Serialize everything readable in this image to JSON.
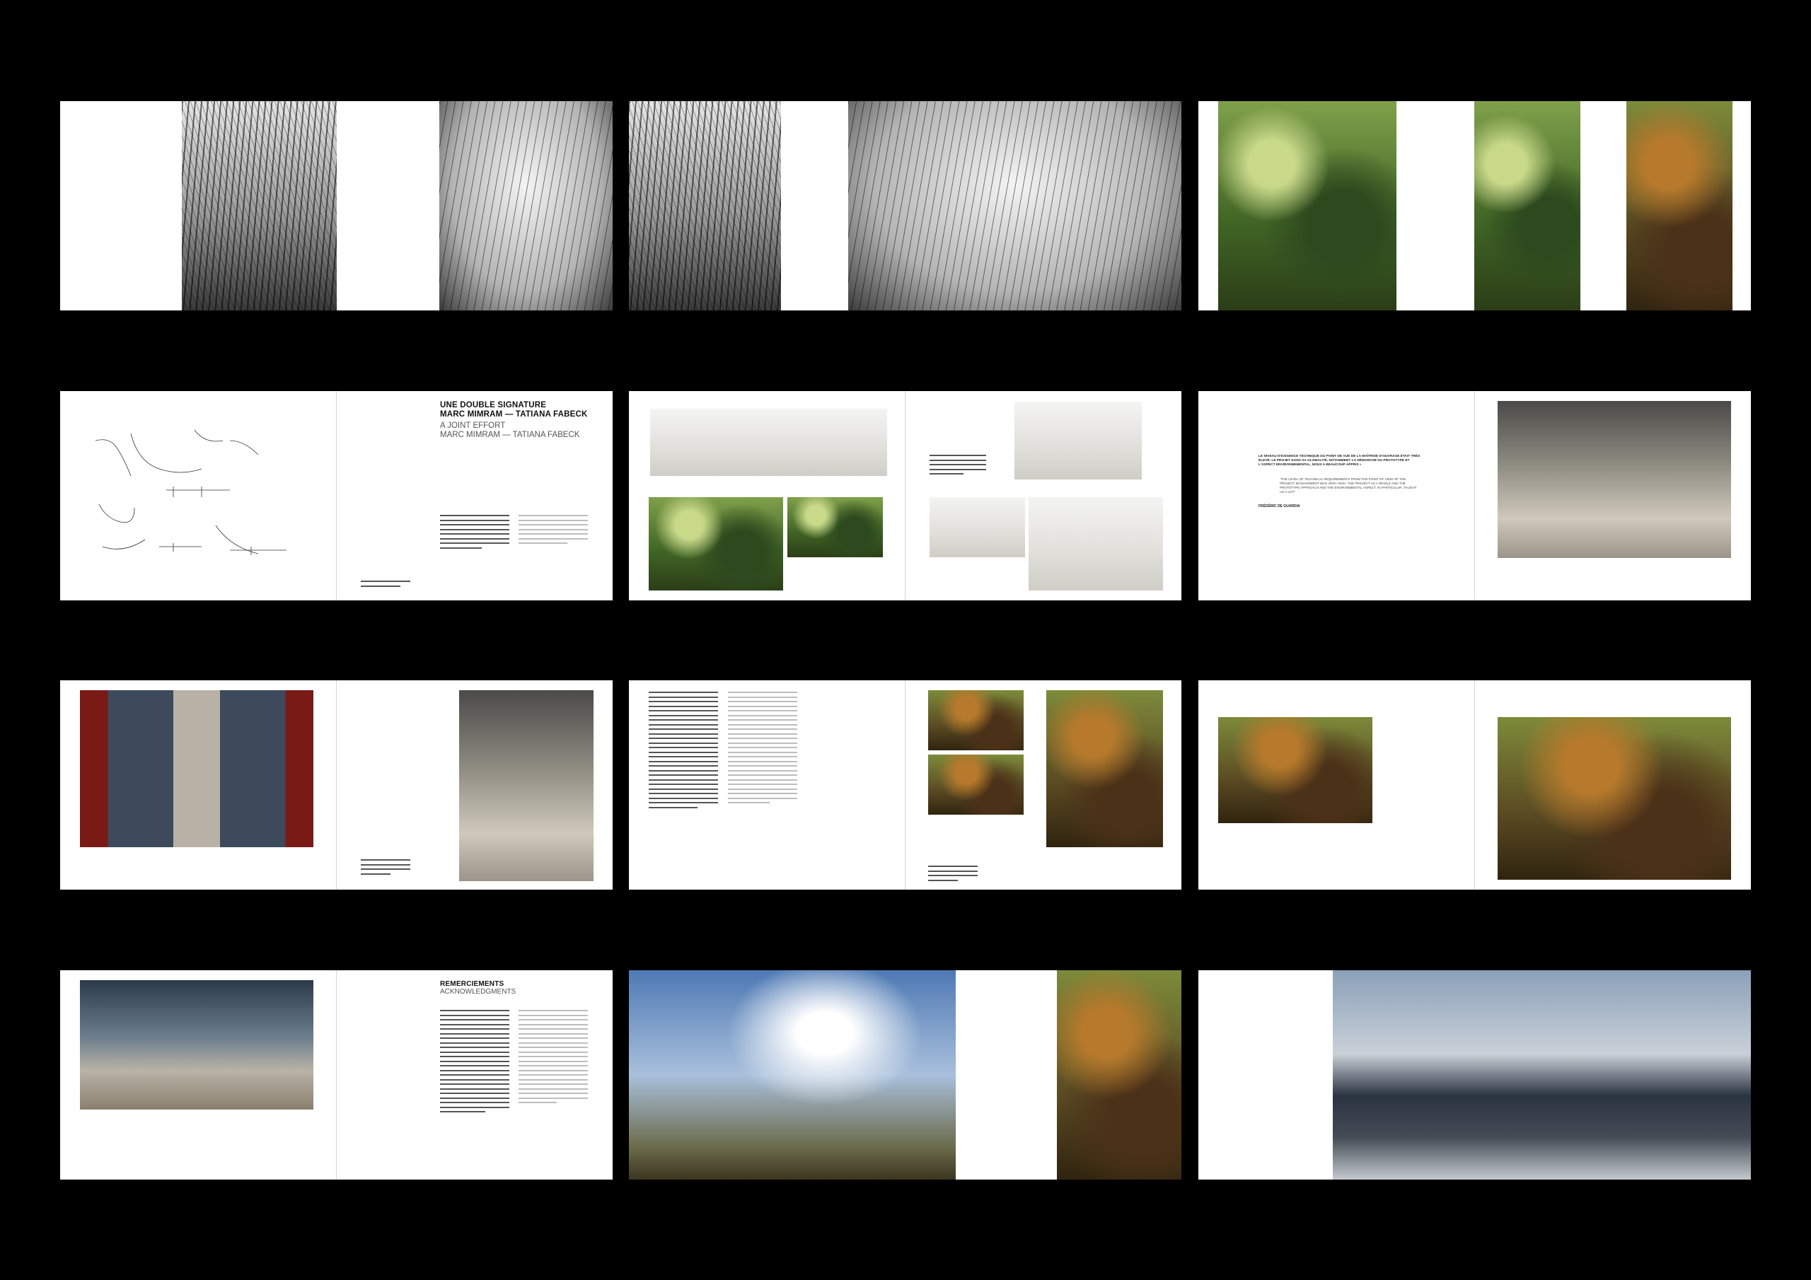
{
  "spreads": {
    "s4": {
      "title": "UNE DOUBLE SIGNATURE\nMARC MIMRAM — TATIANA FABECK",
      "subtitle": "A JOINT EFFORT\nMARC MIMRAM — TATIANA FABECK"
    },
    "s6": {
      "quote_fr": "LE NIVEAU D'EXIGENCE TECHNIQUE DU POINT DE VUE DE LA MAÎTRISE D'OUVRAGE ÉTAIT TRÈS ÉLEVÉ. LE PROJET DANS SA GLOBALITÉ, NOTAMMENT LA DÉMARCHE DU PROTOTYPE ET L'ASPECT ENVIRONNEMENTAL, NOUS A BEAUCOUP APPRIS »",
      "quote_en": "\"THE LEVEL OF TECHNICAL REQUIREMENTS FROM THE POINT OF VIEW OF THE PROJECT MANAGEMENT WAS VERY HIGH. THE PROJECT AS A WHOLE AND THE PROTOTYPE APPROACH AND THE ENVIRONMENTAL ASPECT, IN PARTICULAR, TAUGHT US A LOT\"",
      "author": "FRÉDÉRIC DE GUARDIA"
    },
    "s10": {
      "title": "REMERCIEMENTS",
      "subtitle": "ACKNOWLEDGMENTS"
    }
  }
}
